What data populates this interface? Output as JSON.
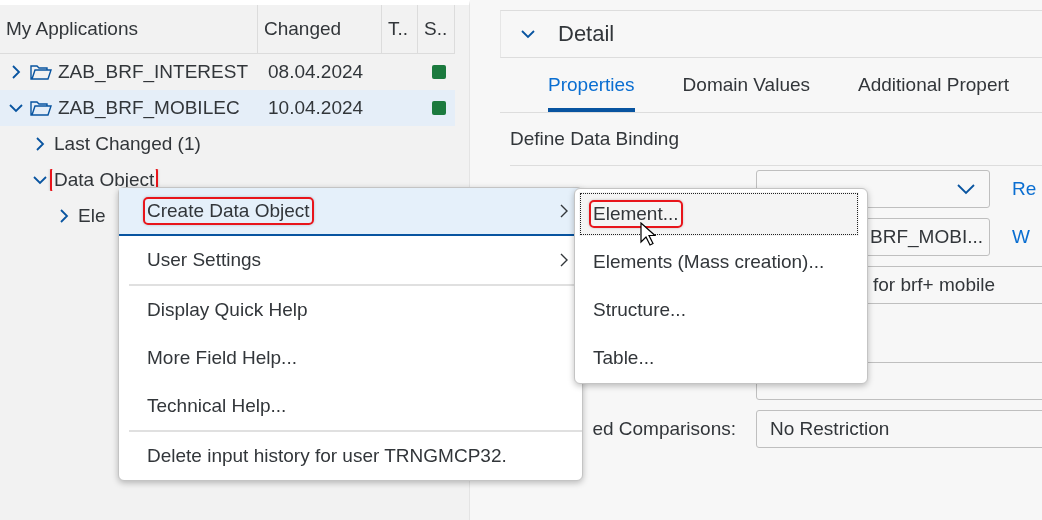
{
  "tree": {
    "columns": [
      "My Applications",
      "Changed",
      "T..",
      "S.."
    ],
    "nodes": [
      {
        "name": "ZAB_BRF_INTEREST",
        "changed": "08.04.2024",
        "color": "#1b7a3e",
        "expanded": false,
        "selected": false,
        "highlighted": false
      },
      {
        "name": "ZAB_BRF_MOBILEC",
        "changed": "10.04.2024",
        "color": "#1b7a3e",
        "expanded": true,
        "selected": true,
        "highlighted": false,
        "children": [
          {
            "name": "Last Changed (1)",
            "expanded": false,
            "selected": false,
            "highlighted": false
          },
          {
            "name": "Data Object",
            "expanded": true,
            "selected": false,
            "highlighted": true,
            "children": [
              {
                "name": "Ele",
                "expanded": false,
                "selected": false,
                "highlighted": false
              }
            ]
          }
        ]
      }
    ]
  },
  "detail": {
    "title": "Detail",
    "expanded": true,
    "tabs": [
      {
        "label": "Properties",
        "selected": true
      },
      {
        "label": "Domain Values",
        "selected": false
      },
      {
        "label": "Additional Propert",
        "selected": false
      }
    ],
    "section": "Define Data Binding",
    "form": [
      {
        "kind": "dropdown",
        "link": "Re"
      },
      {
        "kind": "input",
        "value": "BRF_MOBI...",
        "link": "W"
      },
      {
        "kind": "input",
        "value": "for brf+ mobile"
      },
      {
        "kind": "input"
      },
      {
        "kind": "input",
        "label": "ed Comparisons:",
        "value": "No Restriction"
      }
    ]
  },
  "context_menu": {
    "groups": [
      [
        {
          "label": "Create Data Object",
          "has_submenu": true,
          "selected": true,
          "highlighted": true
        },
        {
          "label": "User Settings",
          "has_submenu": true,
          "selected": false,
          "highlighted": false
        }
      ],
      [
        {
          "label": "Display Quick Help",
          "has_submenu": false,
          "selected": false,
          "highlighted": false
        },
        {
          "label": "More Field Help...",
          "has_submenu": false,
          "selected": false,
          "highlighted": false
        },
        {
          "label": "Technical Help...",
          "has_submenu": false,
          "selected": false,
          "highlighted": false
        }
      ],
      [
        {
          "label": "Delete input history for user TRNGMCP32.",
          "has_submenu": false,
          "selected": false,
          "highlighted": false
        }
      ]
    ]
  },
  "submenu": {
    "items": [
      {
        "label": "Element...",
        "selected": true,
        "highlighted": true
      },
      {
        "label": "Elements (Mass creation)...",
        "selected": false,
        "highlighted": false
      },
      {
        "label": "Structure...",
        "selected": false,
        "highlighted": false
      },
      {
        "label": "Table...",
        "selected": false,
        "highlighted": false
      }
    ]
  }
}
